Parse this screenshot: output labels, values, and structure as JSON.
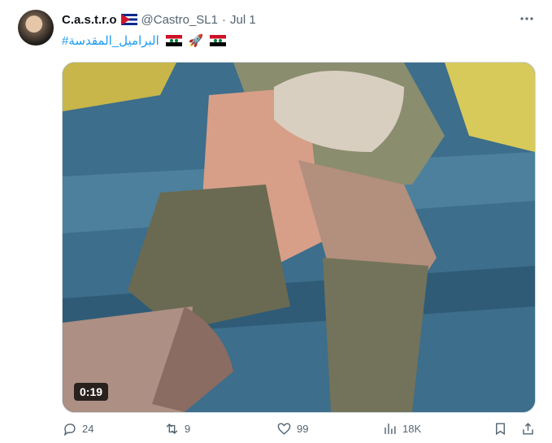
{
  "tweet": {
    "display_name": "C.a.s.t.r.o",
    "handle": "@Castro_SL1",
    "separator": "·",
    "date": "Jul 1",
    "hashtag": "#البراميل_المقدسة",
    "video_duration": "0:19"
  },
  "actions": {
    "replies": "24",
    "retweets": "9",
    "likes": "99",
    "views": "18K"
  },
  "icons": {
    "author_flag": "cuba-flag",
    "emoji_1": "syria-flag",
    "emoji_2": "rocket",
    "emoji_3": "syria-flag"
  },
  "colors": {
    "link": "#1d9bf0",
    "muted": "#536471",
    "text": "#0f1419"
  }
}
